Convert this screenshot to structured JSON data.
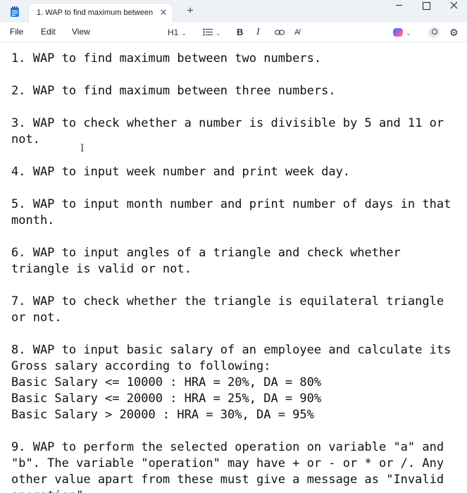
{
  "titlebar": {
    "tab_title": "1. WAP to find maximum between",
    "close_glyph": "✕",
    "new_tab_glyph": "+"
  },
  "menu": {
    "file": "File",
    "edit": "Edit",
    "view": "View"
  },
  "toolbar": {
    "heading": "H1",
    "bold": "B",
    "italic": "I",
    "clear_format": "A̸"
  },
  "document": {
    "lines": [
      "1. WAP to find maximum between two numbers.",
      "",
      "2. WAP to find maximum between three numbers.",
      "",
      "3. WAP to check whether a number is divisible by 5 and 11 or",
      "not.",
      "",
      "4. WAP to input week number and print week day.",
      "",
      "5. WAP to input month number and print number of days in that",
      "month.",
      "",
      "6. WAP to input angles of a triangle and check whether",
      "triangle is valid or not.",
      "",
      "7. WAP to check whether the triangle is equilateral triangle",
      "or not.",
      "",
      "8. WAP to input basic salary of an employee and calculate its",
      "Gross salary according to following:",
      "Basic Salary <= 10000 : HRA = 20%, DA = 80%",
      "Basic Salary <= 20000 : HRA = 25%, DA = 90%",
      "Basic Salary > 20000 : HRA = 30%, DA = 95%",
      "",
      "9. WAP to perform the selected operation on variable \"a\" and",
      "\"b\". The variable \"operation\" may have + or - or * or /. Any",
      "other value apart from these must give a message as \"Invalid",
      "operation\"."
    ]
  },
  "colors": {
    "titlebar_bg": "#eef2f7",
    "editor_bg": "#ffffff",
    "text": "#111111"
  }
}
